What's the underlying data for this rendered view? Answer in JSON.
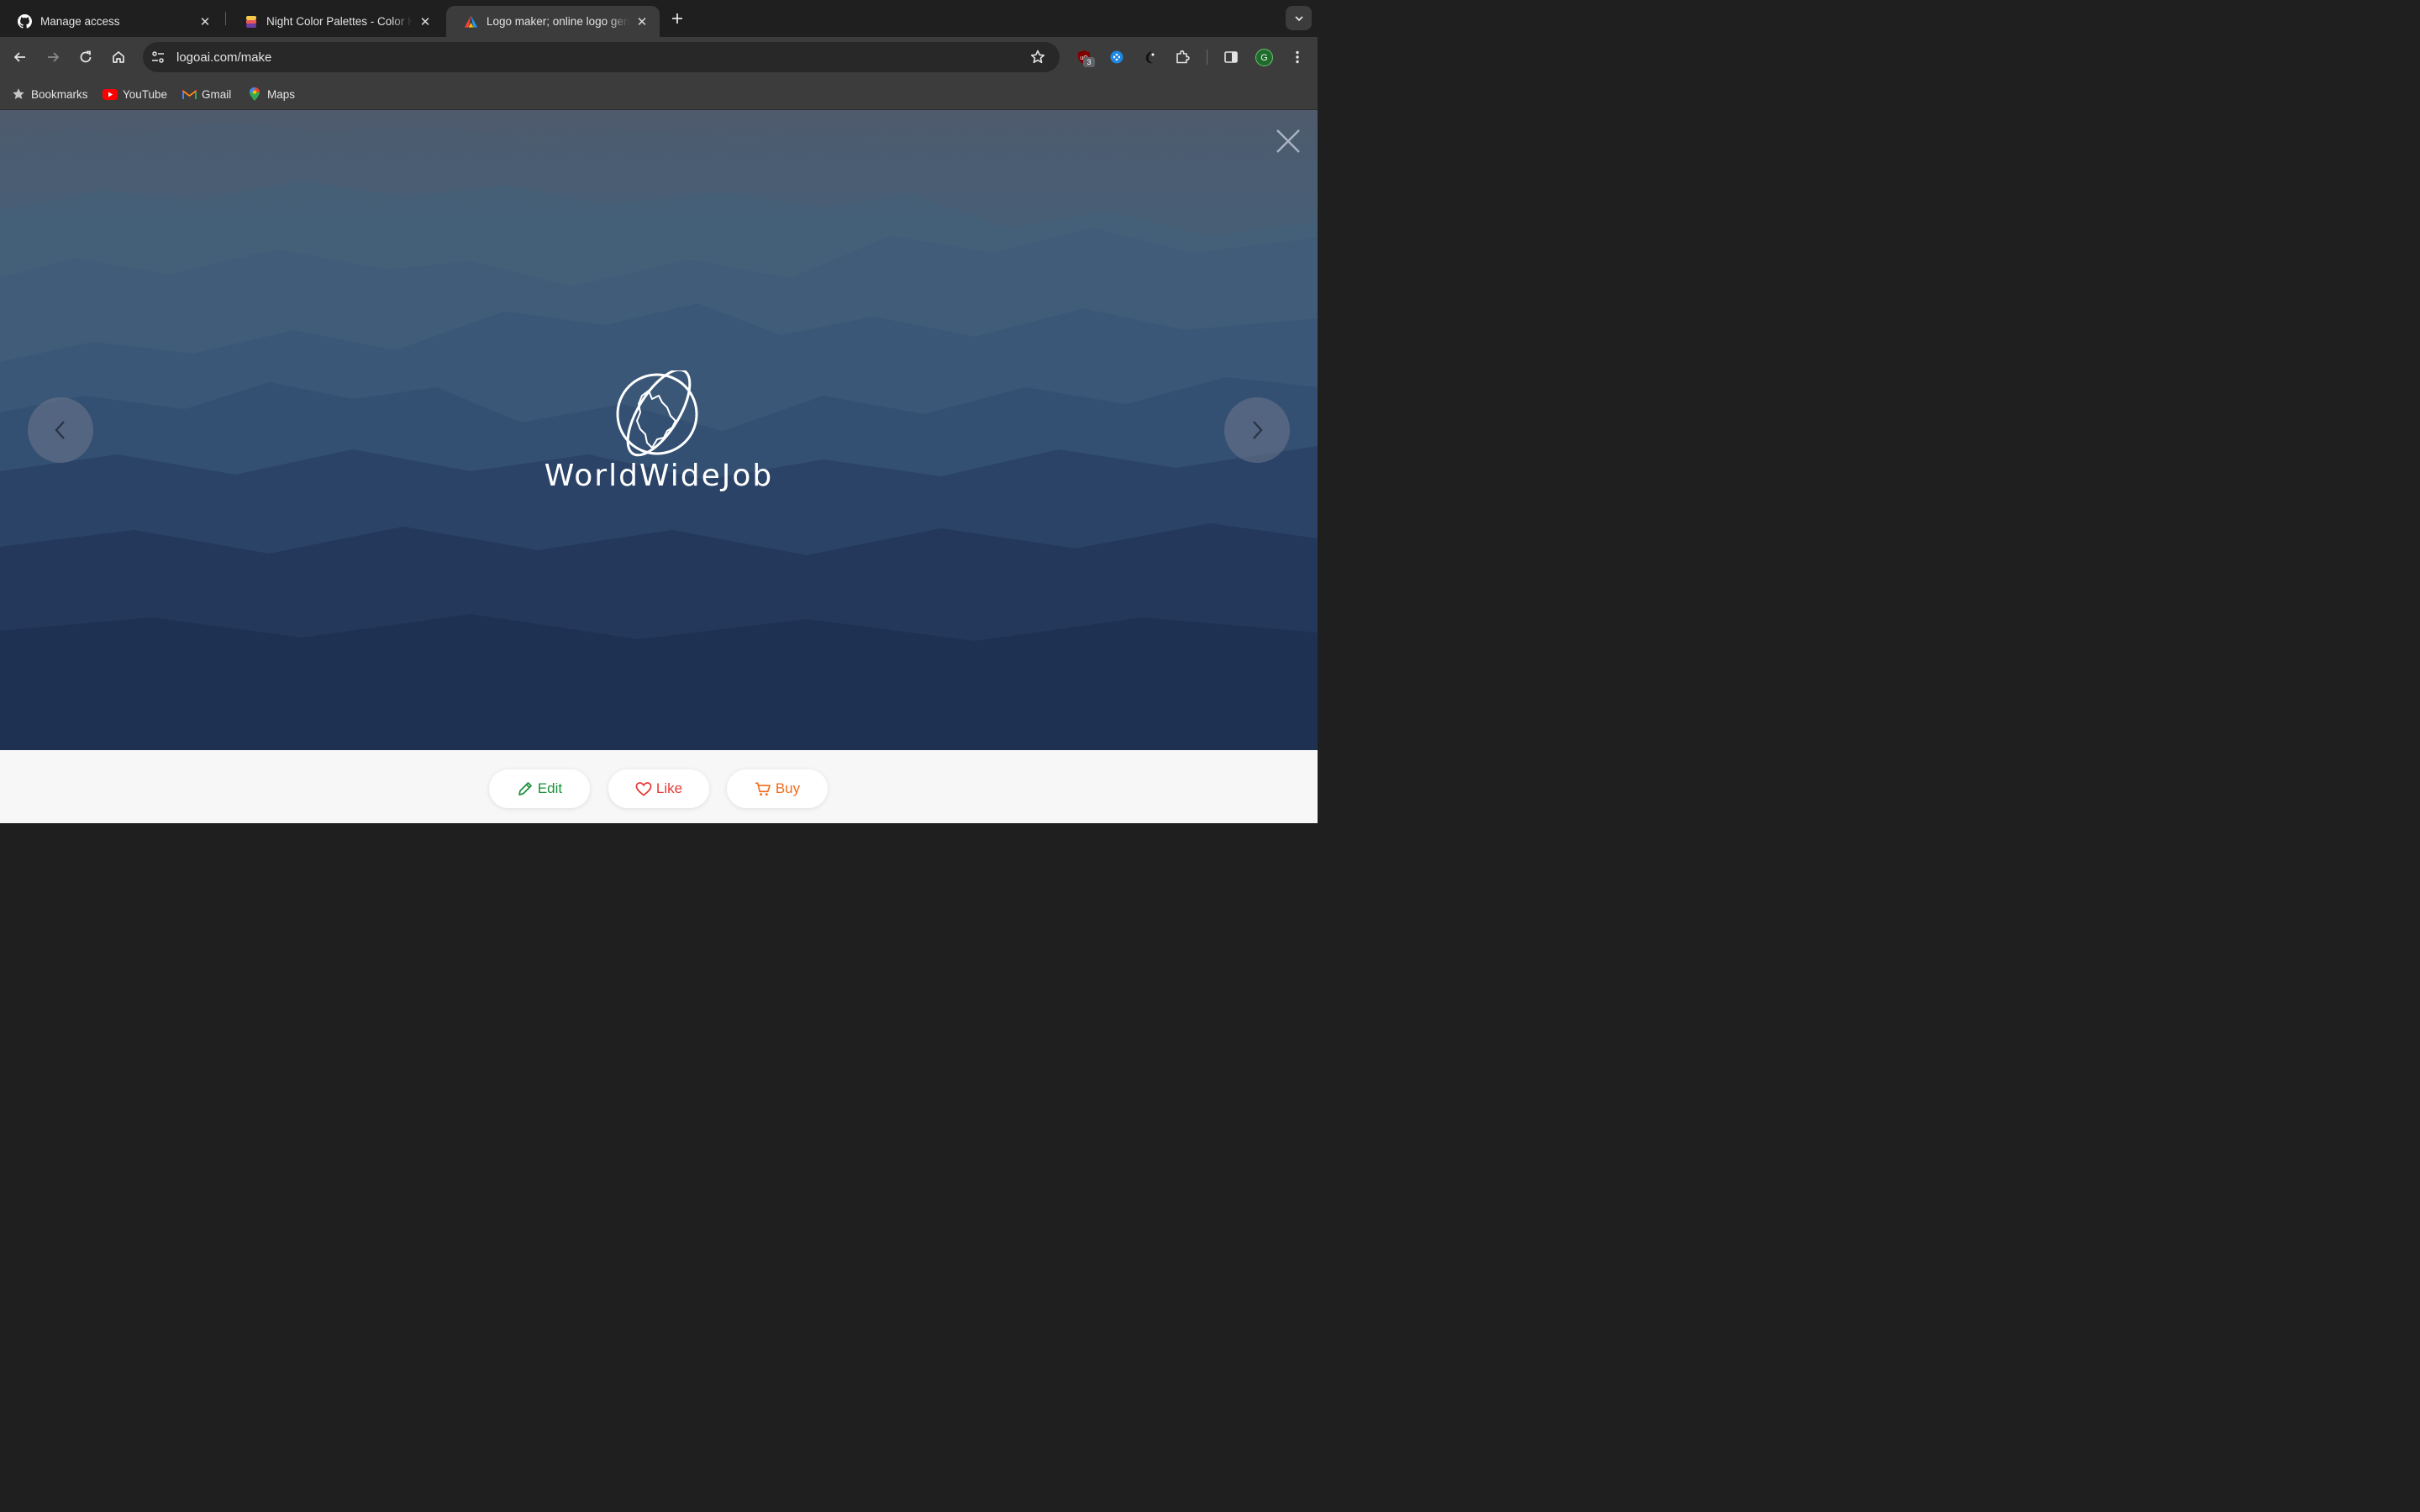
{
  "browser": {
    "tabs": [
      {
        "title": "Manage access",
        "icon": "github-icon",
        "active": false
      },
      {
        "title": "Night Color Palettes - Color H",
        "icon": "color-hunt-icon",
        "active": false
      },
      {
        "title": "Logo maker; online logo gene",
        "icon": "logoai-icon",
        "active": true
      }
    ],
    "url": "logoai.com/make",
    "extension_badge": "3",
    "profile_initial": "G"
  },
  "bookmarks": [
    {
      "label": "Bookmarks",
      "icon": "star-icon"
    },
    {
      "label": "YouTube",
      "icon": "youtube-icon"
    },
    {
      "label": "Gmail",
      "icon": "gmail-icon"
    },
    {
      "label": "Maps",
      "icon": "maps-icon"
    }
  ],
  "preview": {
    "brand_name": "WorldWideJob",
    "emblem": "globe-orbit-icon",
    "background": "misty-mountains"
  },
  "actions": {
    "edit_label": "Edit",
    "like_label": "Like",
    "buy_label": "Buy"
  },
  "colors": {
    "edit": "#1a8f3a",
    "like": "#e53935",
    "buy": "#ef6c1a",
    "browser_chrome": "#3c3c3c"
  }
}
